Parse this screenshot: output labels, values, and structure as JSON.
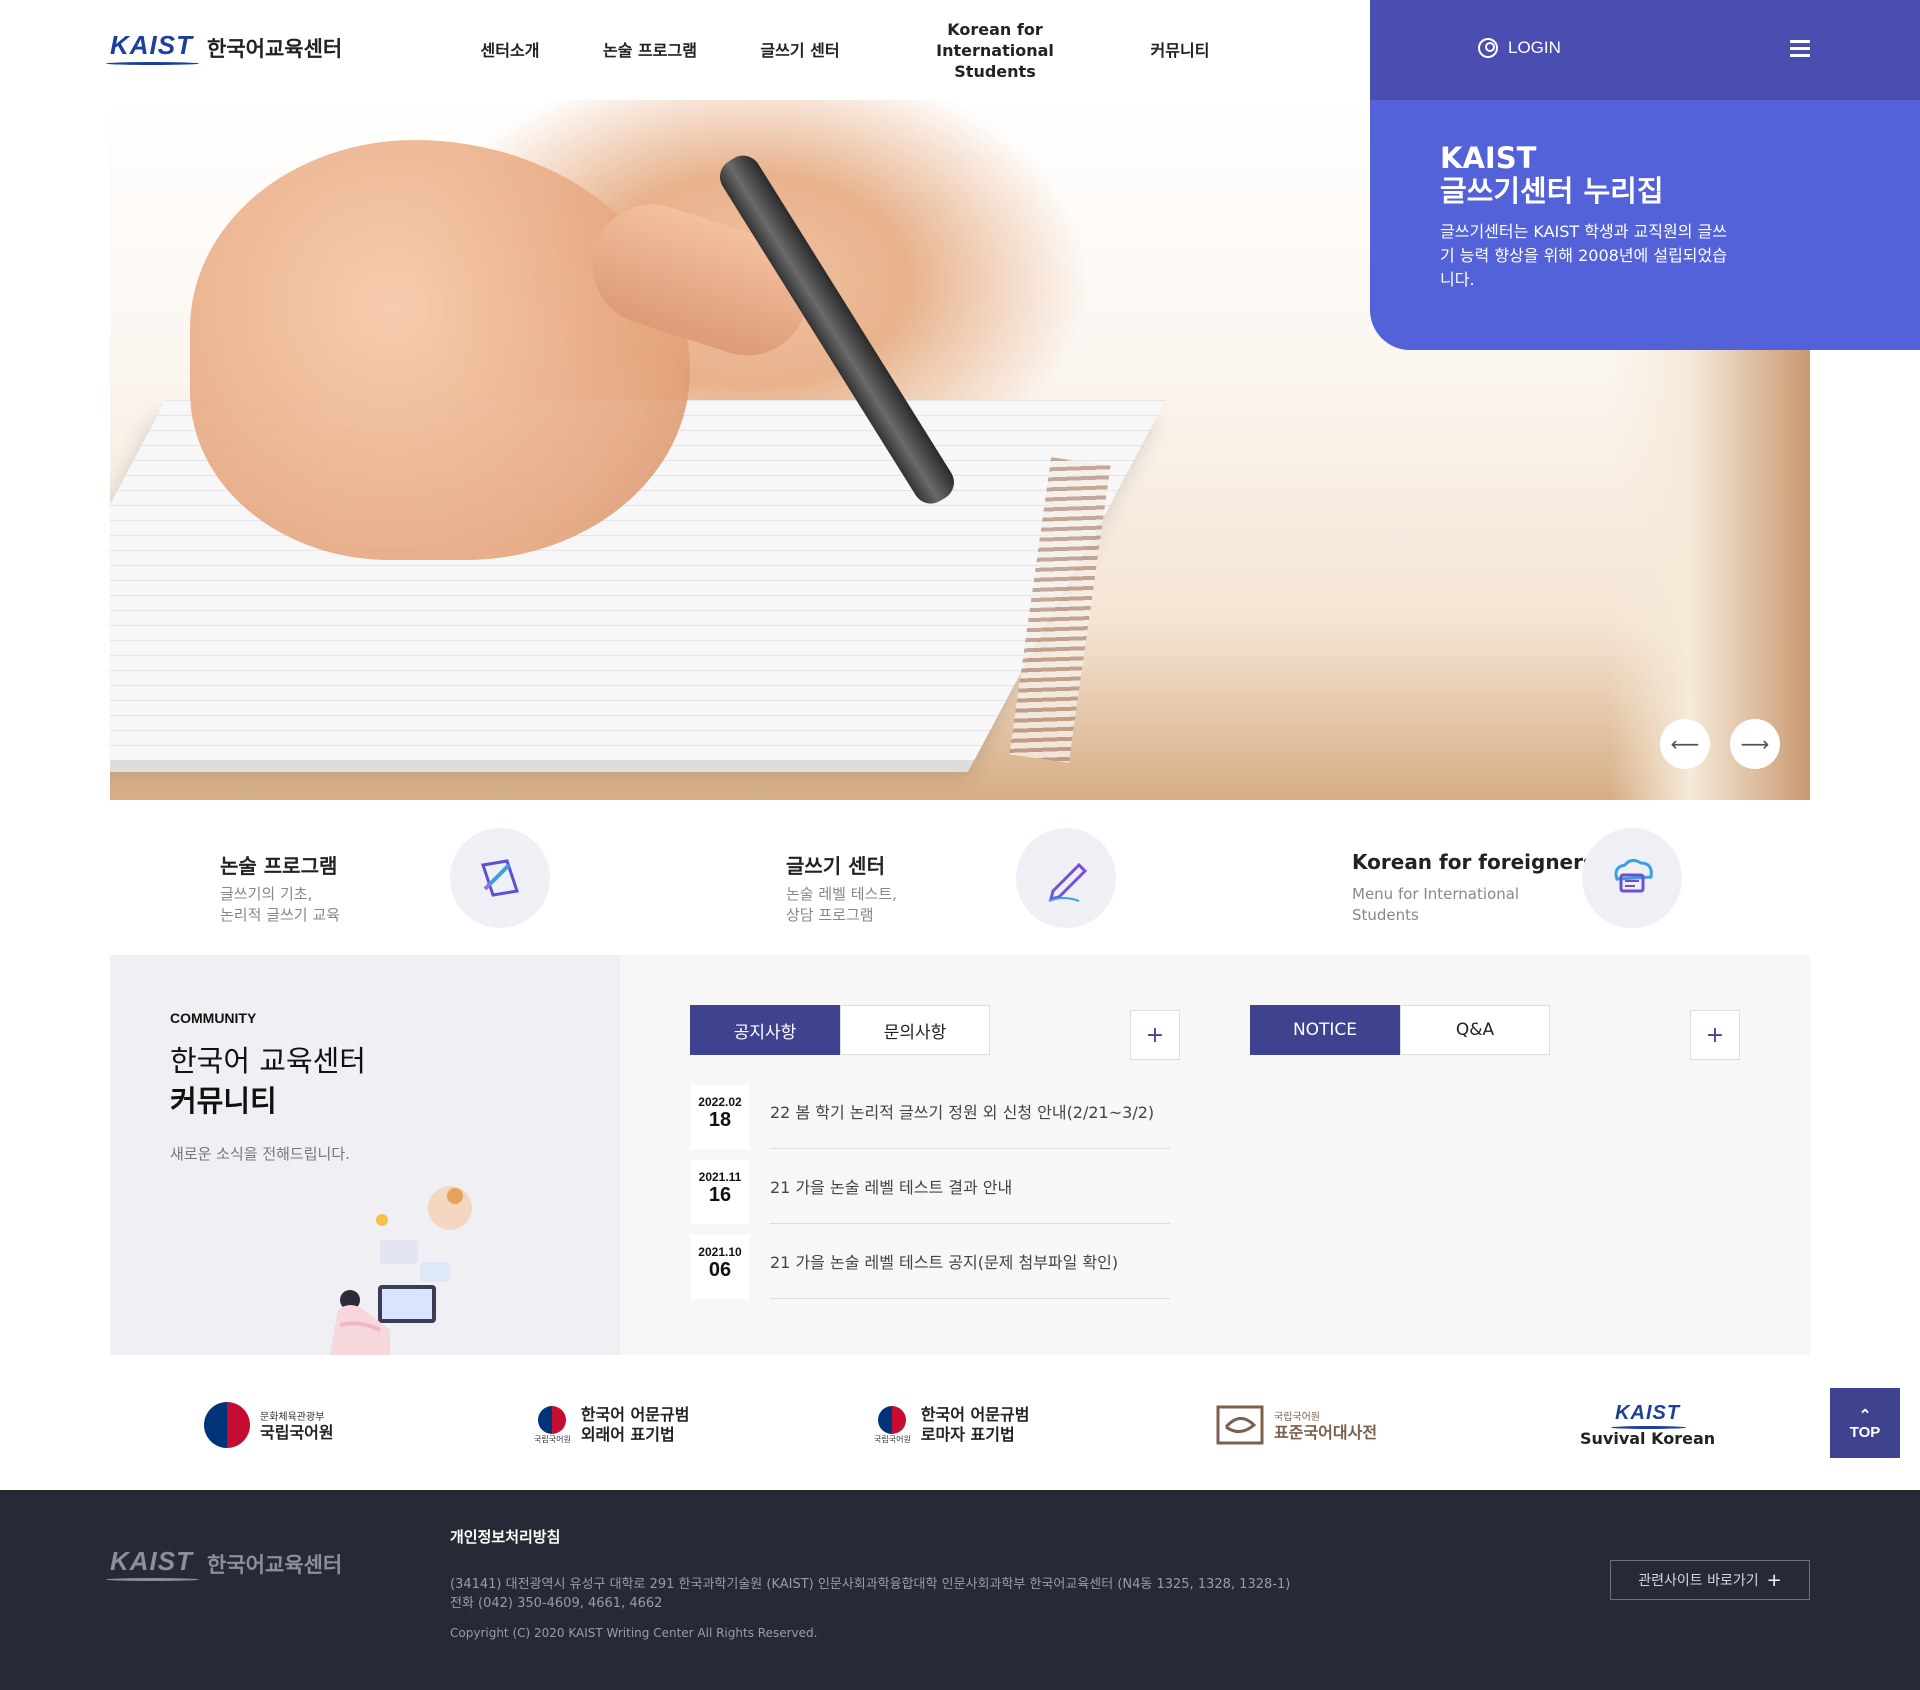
{
  "header": {
    "logo_mark": "KAIST",
    "logo_text": "한국어교육센터",
    "nav": [
      {
        "label": "센터소개"
      },
      {
        "label": "논술 프로그램"
      },
      {
        "label": "글쓰기 센터"
      },
      {
        "label": "Korean for\nInternational Students"
      },
      {
        "label": "커뮤니티"
      }
    ],
    "login_label": "LOGIN"
  },
  "promo": {
    "title_line1": "KAIST",
    "title_line2": "글쓰기센터 누리집",
    "description": "글쓰기센터는 KAIST 학생과 교직원의 글쓰기 능력 향상을 위해 2008년에 설립되었습니다."
  },
  "slider": {
    "prev_symbol": "⟵",
    "next_symbol": "⟶"
  },
  "quick_links": [
    {
      "title": "논술 프로그램",
      "desc_line1": "글쓰기의 기초,",
      "desc_line2": "논리적 글쓰기 교육",
      "icon": "pencil-paper-icon"
    },
    {
      "title": "글쓰기 센터",
      "desc_line1": "논술 레벨 테스트,",
      "desc_line2": "상담 프로그램",
      "icon": "pen-writing-icon"
    },
    {
      "title": "Korean for foreigners",
      "desc_line1": "Menu for International",
      "desc_line2": "Students",
      "icon": "chat-cloud-icon"
    }
  ],
  "community": {
    "label": "COMMUNITY",
    "title_line1": "한국어 교육센터",
    "title_line2": "커뮤니티",
    "description": "새로운 소식을 전해드립니다.",
    "board1": {
      "tabs": [
        "공지사항",
        "문의사항"
      ],
      "more_symbol": "+",
      "items": [
        {
          "ym": "2022.02",
          "day": "18",
          "title": "22 봄 학기 논리적 글쓰기 정원 외 신청 안내(2/21~3/2)"
        },
        {
          "ym": "2021.11",
          "day": "16",
          "title": "21 가을 논술 레벨 테스트 결과 안내"
        },
        {
          "ym": "2021.10",
          "day": "06",
          "title": "21 가을 논술 레벨 테스트 공지(문제 첨부파일 확인)"
        }
      ]
    },
    "board2": {
      "tabs": [
        "NOTICE",
        "Q&A"
      ],
      "more_symbol": "+"
    }
  },
  "related_sites": [
    {
      "small": "문화체육관광부",
      "name": "국립국어원"
    },
    {
      "small": "국립국어원",
      "name_line1": "한국어 어문규범",
      "name_line2": "외래어 표기법"
    },
    {
      "small": "국립국어원",
      "name_line1": "한국어 어문규범",
      "name_line2": "로마자 표기법"
    },
    {
      "small": "국립국어원",
      "name": "표준국어대사전"
    },
    {
      "mark": "KAIST",
      "name": "Suvival Korean"
    }
  ],
  "top_button": {
    "label": "TOP",
    "symbol": "⌃"
  },
  "footer": {
    "logo_mark": "KAIST",
    "logo_text": "한국어교육센터",
    "privacy": "개인정보처리방침",
    "address": "(34141) 대전광역시 유성구 대학로 291 한국과학기술원 (KAIST) 인문사회과학융합대학 인문사회과학부 한국어교육센터 (N4동 1325, 1328, 1328-1)",
    "phone": "전화 (042) 350-4609, 4661, 4662",
    "copyright": "Copyright (C) 2020 KAIST Writing Center All Rights Reserved.",
    "related_label": "관련사이트 바로가기",
    "related_symbol": "+"
  },
  "colors": {
    "primary": "#3f428e",
    "promo_bg": "#5462da",
    "topbar_bg": "#4b4eb1",
    "footer_bg": "#262a36"
  }
}
